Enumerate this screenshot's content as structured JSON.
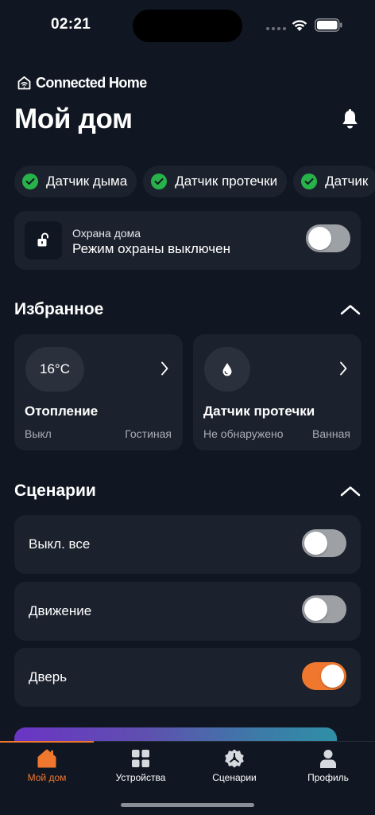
{
  "status_bar": {
    "time": "02:21"
  },
  "header": {
    "brand": "Connected Home",
    "title": "Мой дом"
  },
  "chips": [
    {
      "label": "Датчик дыма"
    },
    {
      "label": "Датчик протечки"
    },
    {
      "label": "Датчик"
    }
  ],
  "security": {
    "label": "Охрана дома",
    "status": "Режим охраны выключен",
    "enabled": false
  },
  "favorites": {
    "title": "Избранное",
    "items": [
      {
        "badge": "16°C",
        "title": "Отопление",
        "status": "Выкл",
        "room": "Гостиная",
        "icon": "thermostat"
      },
      {
        "badge": "",
        "title": "Датчик протечки",
        "status": "Не обнаружено",
        "room": "Ванная",
        "icon": "water-drop-icon"
      }
    ]
  },
  "scenarios": {
    "title": "Сценарии",
    "items": [
      {
        "label": "Выкл. все",
        "enabled": false
      },
      {
        "label": "Движение",
        "enabled": false
      },
      {
        "label": "Дверь",
        "enabled": true
      }
    ]
  },
  "tab_bar": {
    "items": [
      {
        "label": "Мой дом",
        "icon": "house-icon",
        "active": true
      },
      {
        "label": "Устройства",
        "icon": "grid-icon",
        "active": false
      },
      {
        "label": "Сценарии",
        "icon": "scenarios-icon",
        "active": false
      },
      {
        "label": "Профиль",
        "icon": "person-icon",
        "active": false
      }
    ]
  },
  "colors": {
    "background": "#111722",
    "card": "#1c222d",
    "accent": "#f0772e",
    "check": "#27b24a",
    "toggle_off": "#9da1a6"
  }
}
